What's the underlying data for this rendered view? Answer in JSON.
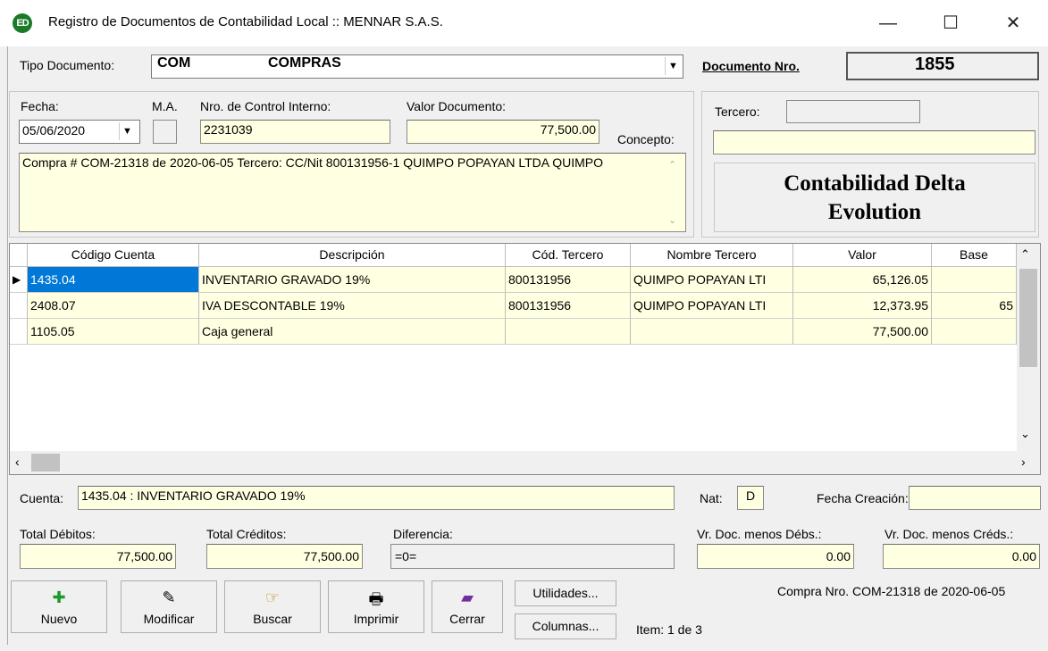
{
  "window": {
    "title": "Registro de Documentos de Contabilidad Local :: MENNAR S.A.S.",
    "logo": "ED"
  },
  "tipo": {
    "label": "Tipo Documento:",
    "code": "COM",
    "name": "COMPRAS"
  },
  "documento": {
    "label": "Documento Nro.",
    "number": "1855"
  },
  "fecha": {
    "label": "Fecha:",
    "value": "05/06/2020"
  },
  "ma": {
    "label": "M.A."
  },
  "control": {
    "label": "Nro. de Control Interno:",
    "value": "2231039"
  },
  "valor_doc": {
    "label": "Valor Documento:",
    "value": "77,500.00"
  },
  "concepto": {
    "label": "Concepto:",
    "text": "Compra # COM-21318 de 2020-06-05 Tercero: CC/Nit 800131956-1 QUIMPO POPAYAN LTDA QUIMPO"
  },
  "tercero": {
    "label": "Tercero:"
  },
  "brand": {
    "line1": "Contabilidad Delta",
    "line2": "Evolution"
  },
  "grid": {
    "headers": [
      "Código Cuenta",
      "Descripción",
      "Cód. Tercero",
      "Nombre Tercero",
      "Valor",
      "Base"
    ],
    "rows": [
      {
        "cuenta": "1435.04",
        "desc": "INVENTARIO GRAVADO 19%",
        "cod_tercero": "800131956",
        "nombre": "QUIMPO POPAYAN LTI",
        "valor": "65,126.05",
        "base": ""
      },
      {
        "cuenta": "2408.07",
        "desc": "IVA DESCONTABLE 19%",
        "cod_tercero": "800131956",
        "nombre": "QUIMPO POPAYAN LTI",
        "valor": "12,373.95",
        "base": "65"
      },
      {
        "cuenta": "1105.05",
        "desc": "Caja general",
        "cod_tercero": "",
        "nombre": "",
        "valor": "77,500.00",
        "base": ""
      }
    ]
  },
  "cuenta": {
    "label": "Cuenta:",
    "value": "1435.04 : INVENTARIO GRAVADO 19%"
  },
  "nat": {
    "label": "Nat:",
    "value": "D"
  },
  "fecha_creacion": {
    "label": "Fecha Creación:"
  },
  "totales": {
    "debitos_label": "Total Débitos:",
    "debitos": "77,500.00",
    "creditos_label": "Total Créditos:",
    "creditos": "77,500.00",
    "diferencia_label": "Diferencia:",
    "diferencia": "=0=",
    "vr_debs_label": "Vr. Doc. menos Débs.:",
    "vr_debs": "0.00",
    "vr_creds_label": "Vr. Doc. menos Créds.:",
    "vr_creds": "0.00"
  },
  "buttons": {
    "nuevo": "Nuevo",
    "modificar": "Modificar",
    "buscar": "Buscar",
    "imprimir": "Imprimir",
    "cerrar": "Cerrar",
    "utilidades": "Utilidades...",
    "columnas": "Columnas..."
  },
  "status": {
    "item": "Item: 1 de 3",
    "compra": "Compra Nro. COM-21318 de 2020-06-05"
  },
  "icons": {
    "minimize": "minimize-icon",
    "maximize": "maximize-icon",
    "close": "close-icon",
    "dropdown": "dropdown-arrow-icon",
    "add": "plus-icon",
    "edit": "edit-icon",
    "search": "search-icon",
    "print": "printer-icon",
    "exit": "exit-door-icon"
  },
  "colors": {
    "field_bg": "#ffffe1",
    "selection": "#0078d7",
    "logo": "#1a7a2a"
  }
}
